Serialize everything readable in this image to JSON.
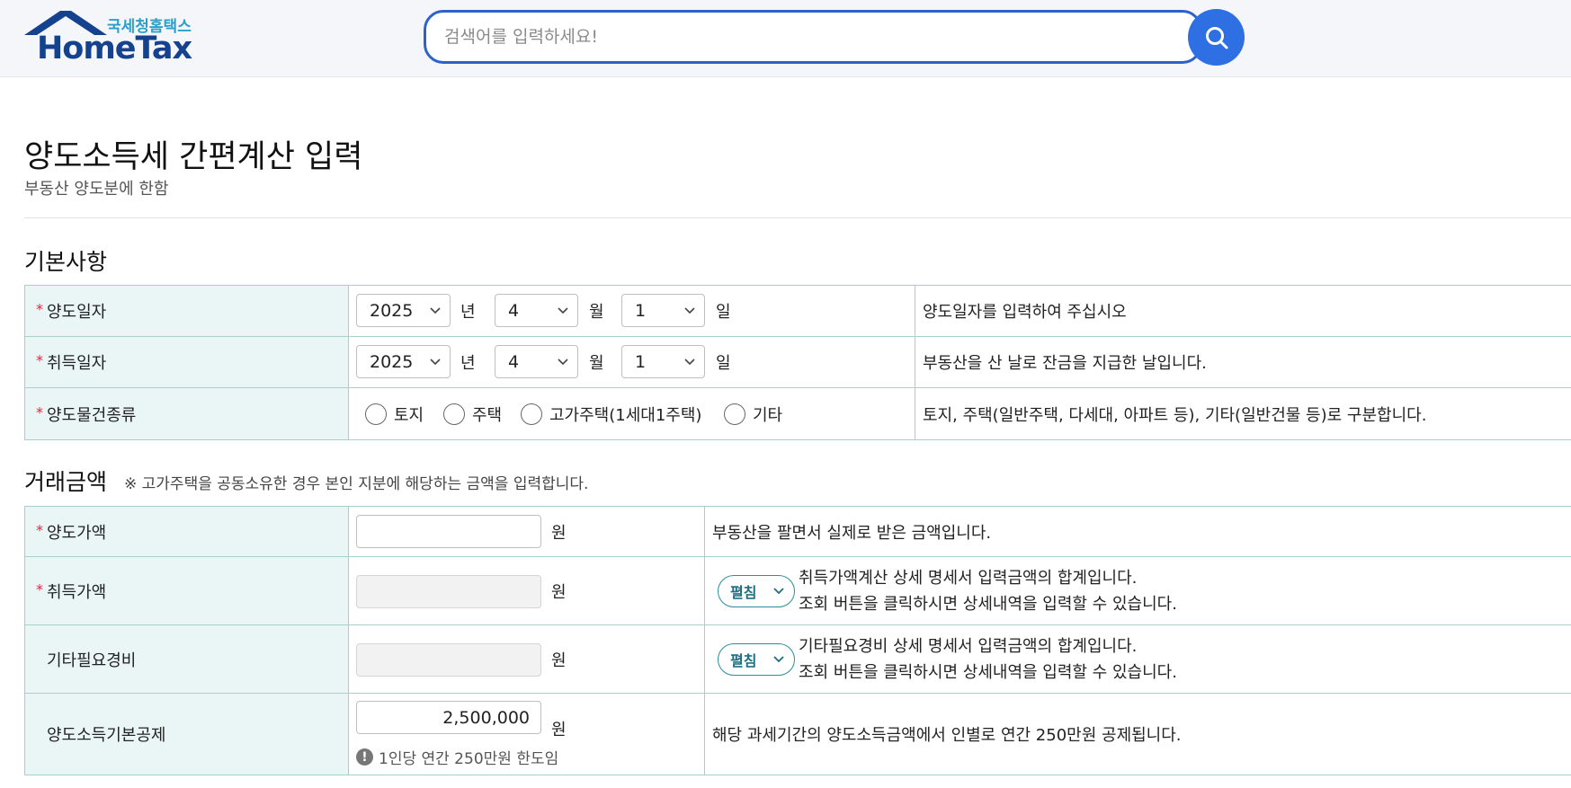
{
  "header": {
    "logo_sub": "국세청홈택스",
    "logo_main": "HomeTax",
    "search_placeholder": "검색어를 입력하세요!"
  },
  "page": {
    "title": "양도소득세 간편계산 입력",
    "subtitle": "부동산 양도분에 한함"
  },
  "basic": {
    "title": "기본사항",
    "rows": [
      {
        "label": "양도일자",
        "year": "2025",
        "year_unit": "년",
        "month": "4",
        "month_unit": "월",
        "day": "1",
        "day_unit": "일",
        "desc": "양도일자를 입력하여 주십시오"
      },
      {
        "label": "취득일자",
        "year": "2025",
        "year_unit": "년",
        "month": "4",
        "month_unit": "월",
        "day": "1",
        "day_unit": "일",
        "desc": "부동산을 산 날로 잔금을 지급한 날입니다."
      }
    ],
    "type_row": {
      "label": "양도물건종류",
      "options": [
        "토지",
        "주택",
        "고가주택(1세대1주택)",
        "기타"
      ],
      "desc": "토지, 주택(일반주택, 다세대, 아파트 등), 기타(일반건물 등)로 구분합니다."
    }
  },
  "amount": {
    "title": "거래금액",
    "note": "※ 고가주택을 공동소유한 경우 본인 지분에 해당하는 금액을 입력합니다.",
    "unit": "원",
    "rows": [
      {
        "label": "양도가액",
        "value": "",
        "desc": "부동산을 팔면서 실제로 받은 금액입니다."
      },
      {
        "label": "취득가액",
        "value": "",
        "expand_label": "펼침",
        "desc_line1": "취득가액계산 상세 명세서 입력금액의 합계입니다.",
        "desc_line2": "조회 버튼을 클릭하시면 상세내역을 입력할 수 있습니다."
      },
      {
        "label": "기타필요경비",
        "value": "",
        "expand_label": "펼침",
        "desc_line1": "기타필요경비 상세 명세서 입력금액의 합계입니다.",
        "desc_line2": "조회 버튼을 클릭하시면 상세내역을 입력할 수 있습니다."
      },
      {
        "label": "양도소득기본공제",
        "value": "2,500,000",
        "hint": "1인당 연간 250만원 한도임",
        "desc": "해당 과세기간의 양도소득금액에서 인별로 연간 250만원 공제됩니다."
      }
    ]
  },
  "colors": {
    "accent_blue": "#2f6fe4",
    "table_header_bg": "#eaf6f5",
    "table_border": "#a9cfcd",
    "required_mark": "#e0263c",
    "logo_navy": "#14428e",
    "logo_teal": "#2a9fc9"
  },
  "icons": {
    "search": "search-icon",
    "chevron": "chevron-down-icon",
    "hint": "exclamation-icon",
    "logo": "house-roof-icon"
  }
}
